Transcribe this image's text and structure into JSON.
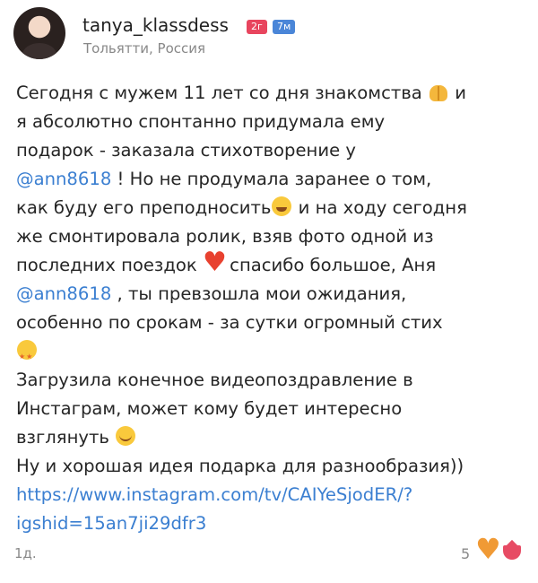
{
  "header": {
    "username": "tanya_klassdess",
    "badge_red": "2г",
    "badge_blue": "7м",
    "location": "Тольятти, Россия"
  },
  "post": {
    "l1": "Сегодня с мужем 11 лет со дня знакомства",
    "l1b": " и",
    "l2": "я абсолютно спонтанно придумала ему",
    "l3": "подарок - заказала стихотворение у",
    "mention1": "@ann8618",
    "l4": " ! Но не продумала заранее о том,",
    "l5": "как буду его преподносить",
    "l5b": " и на ходу сегодня",
    "l6": "же смонтировала ролик, взяв фото одной из",
    "l7": "последних поездок ",
    "l7b": " спасибо большое, Аня",
    "mention2": "@ann8618",
    "l8": " , ты превзошла мои ожидания,",
    "l9": "особенно по срокам - за сутки огромный стих",
    "l11": "Загрузила конечное видеопоздравление в",
    "l12": "Инстаграм, может кому будет интересно",
    "l13": "взглянуть ",
    "l14": "Ну и хорошая идея подарка для разнообразия))",
    "link1": "https://www.instagram.com/tv/CAIYeSjodER/?",
    "link2": "igshid=15an7ji29dfr3"
  },
  "footer": {
    "time": "1д.",
    "likes": "5"
  },
  "icons": {
    "raised_hands": "raised-hands-icon",
    "sweat_smile": "sweat-smile-icon",
    "heart": "heart-icon",
    "star_struck": "star-struck-icon",
    "blush": "blush-icon",
    "like": "like-heart-icon",
    "class": "class-icon"
  },
  "colors": {
    "link": "#3b7fd1",
    "badge_red": "#e8455e",
    "badge_blue": "#4a86d8",
    "like": "#f09a35"
  }
}
